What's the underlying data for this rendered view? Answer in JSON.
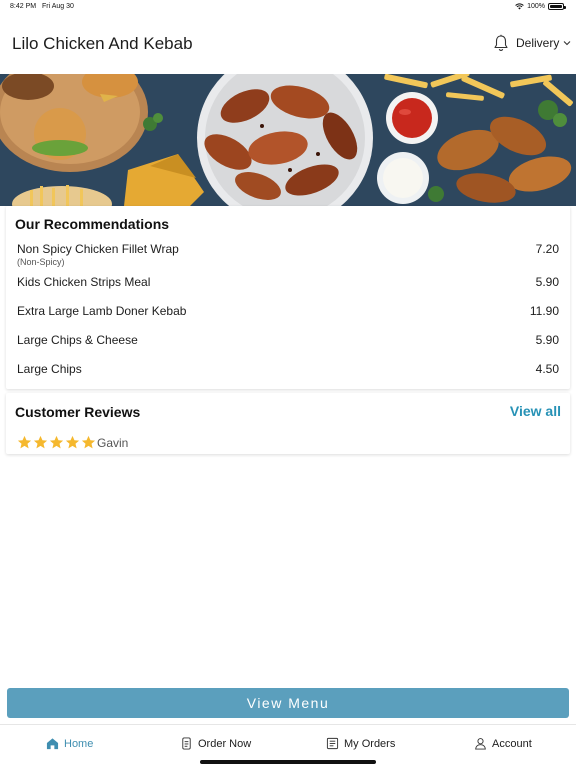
{
  "status_bar": {
    "time": "8:42 PM",
    "date": "Fri Aug 30",
    "battery": "100%"
  },
  "header": {
    "title": "Lilo Chicken And Kebab",
    "mode": "Delivery"
  },
  "recommendations": {
    "title": "Our Recommendations",
    "items": [
      {
        "name": "Non Spicy Chicken Fillet Wrap",
        "note": "(Non-Spicy)",
        "price": "7.20"
      },
      {
        "name": "Kids Chicken Strips Meal",
        "note": "",
        "price": "5.90"
      },
      {
        "name": "Extra Large Lamb Doner Kebab",
        "note": "",
        "price": "11.90"
      },
      {
        "name": "Large Chips & Cheese",
        "note": "",
        "price": "5.90"
      },
      {
        "name": "Large Chips",
        "note": "",
        "price": "4.50"
      }
    ]
  },
  "reviews": {
    "title": "Customer Reviews",
    "view_all_label": "View all",
    "items": [
      {
        "rating": 5,
        "reviewer": "Gavin"
      }
    ]
  },
  "view_menu_label": "View Menu",
  "tabs": [
    {
      "label": "Home",
      "icon": "home-icon",
      "active": true
    },
    {
      "label": "Order Now",
      "icon": "order-icon",
      "active": false
    },
    {
      "label": "My Orders",
      "icon": "receipt-icon",
      "active": false
    },
    {
      "label": "Account",
      "icon": "user-icon",
      "active": false
    }
  ],
  "colors": {
    "accent": "#2792b6",
    "button": "#5b9fbd",
    "star": "#f5b82e",
    "hero_bg": "#2b4258"
  }
}
